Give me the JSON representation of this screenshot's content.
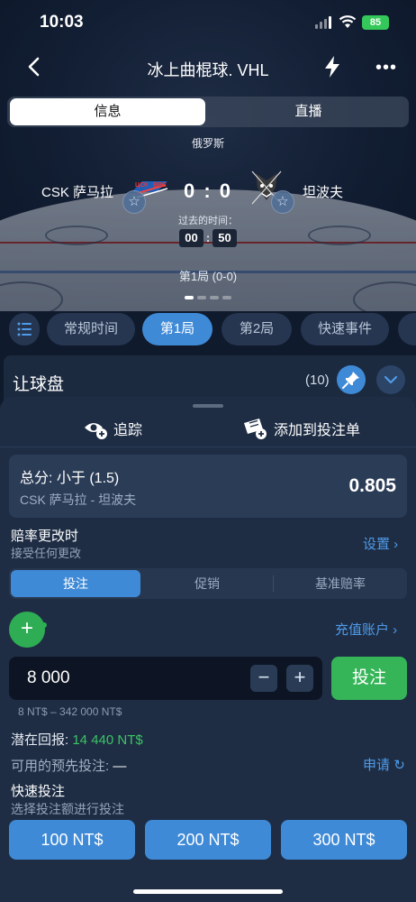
{
  "status_bar": {
    "time": "10:03",
    "battery": "85"
  },
  "header": {
    "title": "冰上曲棍球. VHL"
  },
  "view_tabs": [
    "信息",
    "直播"
  ],
  "match": {
    "country": "俄罗斯",
    "home_team": "CSK 萨马拉",
    "away_team": "坦波夫",
    "score": "0 : 0",
    "elapsed_label": "过去的时间：",
    "minutes": "00",
    "seconds": "50",
    "period": "第1局 (0-0)"
  },
  "period_tabs": [
    "常规时间",
    "第1局",
    "第2局",
    "快速事件"
  ],
  "market": {
    "name": "让球盘",
    "count": "(10)"
  },
  "sheet": {
    "track_label": "追踪",
    "add_slip_label": "添加到投注单",
    "selection": {
      "bet": "总分: 小于 (1.5)",
      "match": "CSK 萨马拉 - 坦波夫",
      "odds": "0.805"
    },
    "odds_change": {
      "title": "赔率更改时",
      "subtitle": "接受任何更改",
      "link": "设置 ›"
    },
    "bet_tabs": [
      "投注",
      "促销",
      "基准赔率"
    ],
    "topup": "充值账户 ›",
    "stake": "8 000",
    "place_label": "投注",
    "range": "8 NT$ – 342 000 NT$",
    "potential_label": "潜在回报:",
    "potential_value": "14 440 NT$",
    "freebet_label": "可用的预先投注:",
    "freebet_value": "—",
    "apply_label": "申请",
    "quick_title": "快速投注",
    "quick_sub": "选择投注额进行投注",
    "quick_amounts": [
      "100 NT$",
      "200 NT$",
      "300 NT$"
    ]
  },
  "colors": {
    "accent": "#3f8ad7",
    "success": "#35b558",
    "background": "#1e2d44"
  },
  "icons": [
    "back-icon",
    "lightning-icon",
    "more-icon",
    "star-icon",
    "list-icon",
    "pin-icon",
    "chevron-down-icon",
    "track-icon",
    "coupon-add-icon",
    "plus-icon",
    "minus-icon",
    "refresh-icon"
  ]
}
